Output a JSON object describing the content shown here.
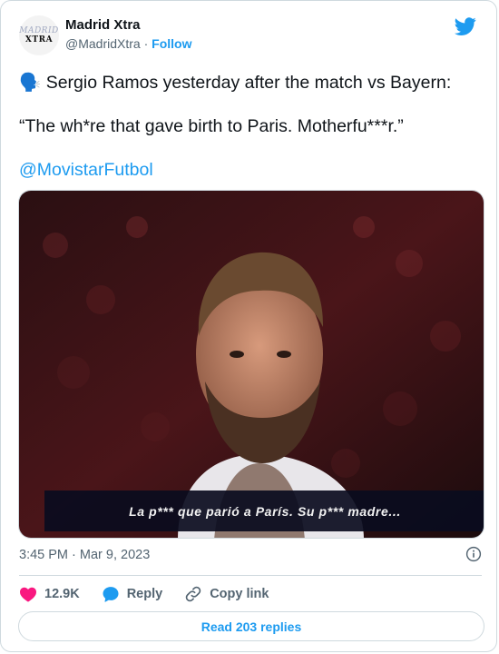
{
  "account": {
    "avatar_line1": "MADRID",
    "avatar_line2": "XTRA",
    "name": "Madrid Xtra",
    "handle": "@MadridXtra",
    "separator": "·",
    "follow_label": "Follow"
  },
  "tweet": {
    "emoji": "🗣️",
    "line1": "Sergio Ramos yesterday after the match vs Bayern:",
    "line2": "“The wh*re that gave birth to Paris. Motherfu***r.”",
    "mention": "@MovistarFutbol"
  },
  "media": {
    "subtitle": "La p*** que parió a París. Su p*** madre..."
  },
  "meta": {
    "time": "3:45 PM",
    "separator": "·",
    "date": "Mar 9, 2023"
  },
  "actions": {
    "likes": "12.9K",
    "reply_label": "Reply",
    "copy_label": "Copy link"
  },
  "read_replies_label": "Read 203 replies",
  "colors": {
    "accent": "#1d9bf0",
    "like": "#f91880",
    "muted": "#536471",
    "border": "#cfd9de"
  }
}
